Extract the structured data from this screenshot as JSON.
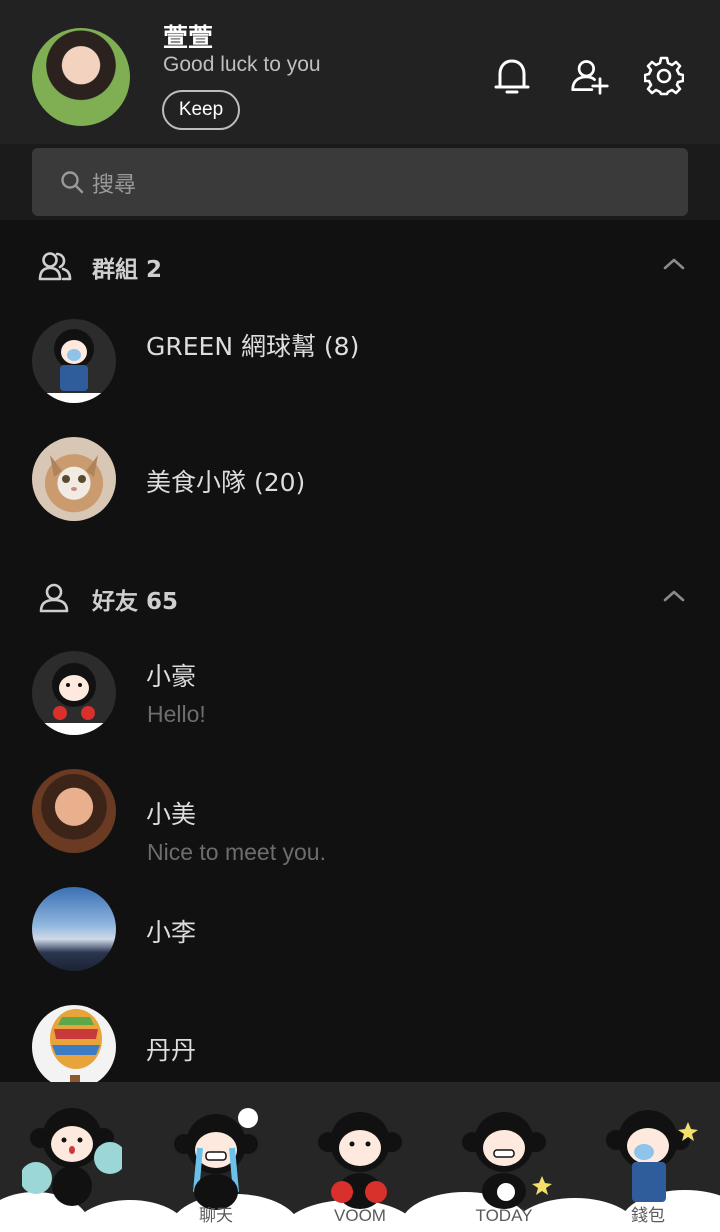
{
  "profile": {
    "name": "萱萱",
    "status": "Good luck to you",
    "keep_label": "Keep"
  },
  "header_icons": [
    "bell-icon",
    "add-friend-icon",
    "settings-gear-icon"
  ],
  "search": {
    "placeholder": "搜尋"
  },
  "groups_section": {
    "title": "群組 2"
  },
  "groups": [
    {
      "name": "GREEN 網球幫 (8)"
    },
    {
      "name": "美食小隊 (20)"
    }
  ],
  "friends_section": {
    "title": "好友 65"
  },
  "friends": [
    {
      "name": "小豪",
      "status": "Hello!"
    },
    {
      "name": "小美",
      "status": "Nice to meet you."
    },
    {
      "name": "小李"
    },
    {
      "name": "丹丹"
    }
  ],
  "tabs": [
    {
      "label": ""
    },
    {
      "label": "聊天"
    },
    {
      "label": "VOOM"
    },
    {
      "label": "TODAY"
    },
    {
      "label": "錢包"
    }
  ],
  "colors": {
    "background": "#111111",
    "header": "#222222",
    "search_box": "#3a3a3a"
  }
}
